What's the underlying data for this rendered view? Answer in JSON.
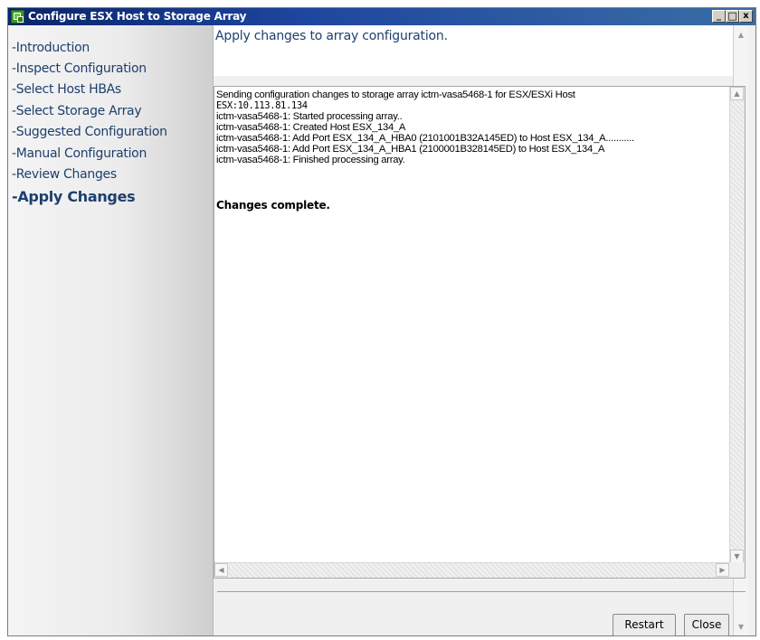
{
  "window": {
    "title": "Configure ESX Host to Storage Array",
    "controls": {
      "minimize": "_",
      "maximize": "□",
      "close": "x"
    }
  },
  "sidebar": {
    "items": [
      {
        "label": "-Introduction"
      },
      {
        "label": "-Inspect Configuration"
      },
      {
        "label": "-Select Host HBAs"
      },
      {
        "label": "-Select Storage Array"
      },
      {
        "label": "-Suggested Configuration"
      },
      {
        "label": "-Manual Configuration"
      },
      {
        "label": "-Review Changes"
      },
      {
        "label": "-Apply Changes",
        "active": true
      }
    ]
  },
  "main": {
    "title": "Apply changes to array configuration.",
    "log": [
      "Sending configuration changes to storage array ictm-vasa5468-1 for ESX/ESXi Host",
      "ESX:10.113.81.134",
      "ictm-vasa5468-1: Started processing array..",
      "ictm-vasa5468-1: Created Host ESX_134_A",
      "ictm-vasa5468-1: Add Port ESX_134_A_HBA0 (2101001B32A145ED) to Host ESX_134_A...........",
      "ictm-vasa5468-1: Add Port ESX_134_A_HBA1 (2100001B328145ED) to Host ESX_134_A",
      "ictm-vasa5468-1: Finished processing array."
    ],
    "status": "Changes complete."
  },
  "buttons": {
    "restart": "Restart",
    "close": "Close"
  }
}
